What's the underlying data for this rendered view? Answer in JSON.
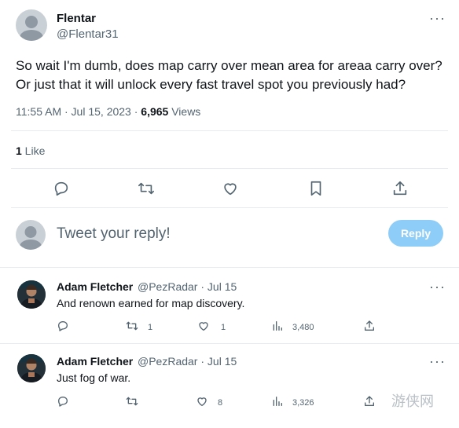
{
  "tweet": {
    "author_name": "Flentar",
    "author_handle": "@Flentar31",
    "more_icon": "more-horizontal-icon",
    "text": "So wait I'm dumb, does map carry over mean area for areaa carry over? Or just that it will unlock every fast travel spot you previously had?",
    "time": "11:55 AM · Jul 15, 2023 · ",
    "views_count": "6,965",
    "views_label": " Views",
    "likes_count": "1",
    "likes_label": " Like"
  },
  "actions": {
    "icons": [
      "reply-icon",
      "retweet-icon",
      "like-icon",
      "bookmark-icon",
      "share-icon"
    ]
  },
  "compose": {
    "placeholder": "Tweet your reply!",
    "button_label": "Reply"
  },
  "replies": [
    {
      "name": "Adam Fletcher",
      "handle_time": "@PezRadar · Jul 15",
      "text": "And renown earned for map discovery.",
      "retweets": "1",
      "likes": "1",
      "views": "3,480"
    },
    {
      "name": "Adam Fletcher",
      "handle_time": "@PezRadar · Jul 15",
      "text": "Just fog of war.",
      "retweets": "",
      "likes": "8",
      "views": "3,326"
    }
  ],
  "watermark": "游侠网",
  "colors": {
    "accent": "#1d9bf0",
    "reply_button": "#8ecdf8",
    "secondary_text": "#536471",
    "divider": "#e6ebef"
  }
}
